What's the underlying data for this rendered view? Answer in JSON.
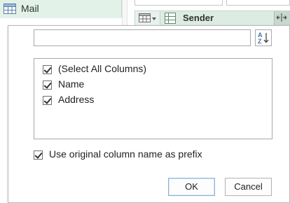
{
  "background": {
    "query_name": "Mail",
    "column_header": "Sender"
  },
  "icons": {
    "table": "table-icon",
    "column_type": "table-type-icon",
    "expand": "expand-column-icon",
    "sort": "sort-az-icon"
  },
  "popup": {
    "search": {
      "value": "",
      "placeholder": ""
    },
    "columns": [
      {
        "label": "(Select All Columns)",
        "checked": true
      },
      {
        "label": "Name",
        "checked": true
      },
      {
        "label": "Address",
        "checked": true
      }
    ],
    "prefix_option": {
      "label": "Use original column name as prefix",
      "checked": true
    },
    "ok_label": "OK",
    "cancel_label": "Cancel"
  },
  "colors": {
    "header_green": "#dcece2",
    "query_green": "#e2f2e8",
    "ok_border": "#8fb1d8"
  }
}
